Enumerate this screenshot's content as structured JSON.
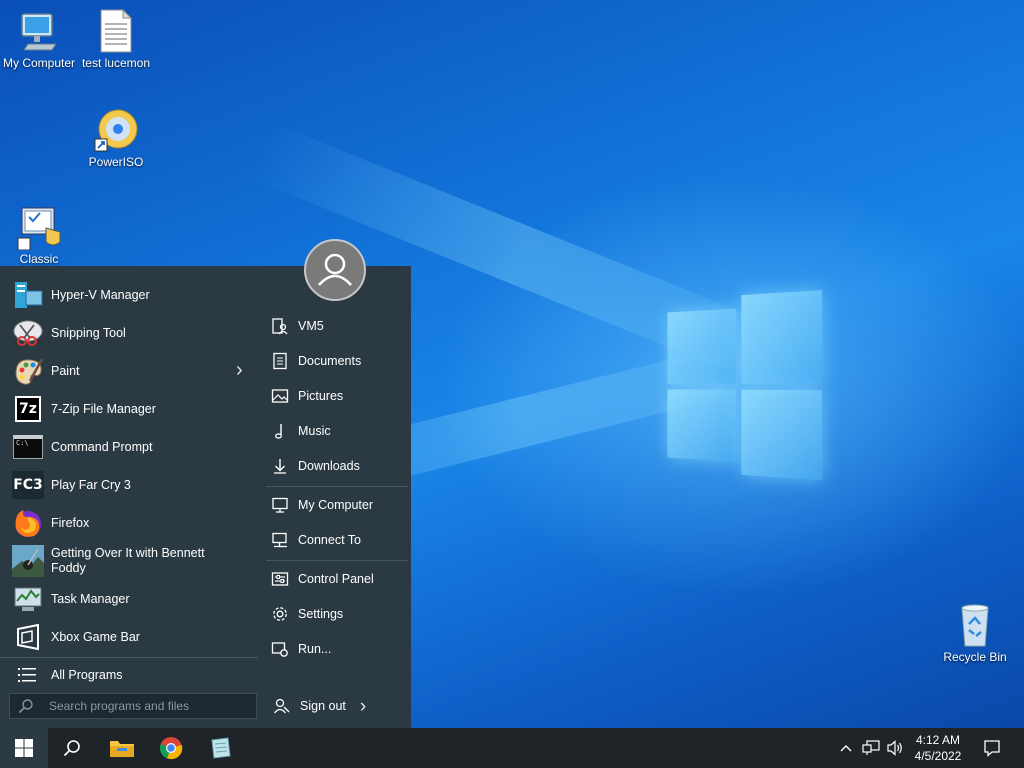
{
  "desktop": {
    "icons": [
      {
        "label": "My Computer",
        "icon": "monitor-icon"
      },
      {
        "label": "test lucemon",
        "icon": "text-file-icon"
      },
      {
        "label": "PowerISO",
        "icon": "disc-icon"
      },
      {
        "label": "Classic",
        "icon": "classic-shell-icon"
      },
      {
        "label": "Recycle Bin",
        "icon": "recycle-bin-icon"
      }
    ]
  },
  "start_menu": {
    "programs": [
      {
        "label": "Hyper-V Manager",
        "icon": "hyperv-icon"
      },
      {
        "label": "Snipping Tool",
        "icon": "scissors-icon"
      },
      {
        "label": "Paint",
        "icon": "palette-icon",
        "submenu_arrow": "›"
      },
      {
        "label": "7-Zip File Manager",
        "icon": "seven-zip-icon",
        "badge": "7z"
      },
      {
        "label": "Command Prompt",
        "icon": "terminal-icon",
        "badge": "C:\\"
      },
      {
        "label": "Play Far Cry 3",
        "icon": "farcry-icon",
        "badge": "FC3"
      },
      {
        "label": "Firefox",
        "icon": "firefox-icon"
      },
      {
        "label": "Getting Over It with Bennett Foddy",
        "icon": "game-icon"
      },
      {
        "label": "Task Manager",
        "icon": "task-manager-icon"
      },
      {
        "label": "Xbox Game Bar",
        "icon": "xbox-icon"
      }
    ],
    "all_programs": "All Programs",
    "search_placeholder": "Search programs and files",
    "right_items": [
      {
        "label": "VM5",
        "icon": "user-folder-icon"
      },
      {
        "label": "Documents",
        "icon": "document-icon"
      },
      {
        "label": "Pictures",
        "icon": "picture-icon"
      },
      {
        "label": "Music",
        "icon": "music-note-icon"
      },
      {
        "label": "Downloads",
        "icon": "download-icon"
      },
      {
        "label": "My Computer",
        "icon": "computer-icon"
      },
      {
        "label": "Connect To",
        "icon": "network-icon"
      },
      {
        "label": "Control Panel",
        "icon": "control-panel-icon"
      },
      {
        "label": "Settings",
        "icon": "gear-icon"
      },
      {
        "label": "Run...",
        "icon": "run-icon"
      }
    ],
    "sign_out": "Sign out",
    "sign_out_arrow": "›"
  },
  "taskbar": {
    "time": "4:12 AM",
    "date": "4/5/2022",
    "tray_chevron": "^",
    "pinned": [
      "file-explorer-icon",
      "chrome-icon",
      "notepad-icon"
    ]
  },
  "colors": {
    "menu_bg": "#2b3a42",
    "taskbar_bg": "#1e2428",
    "desktop_blue": "#1273d8"
  }
}
